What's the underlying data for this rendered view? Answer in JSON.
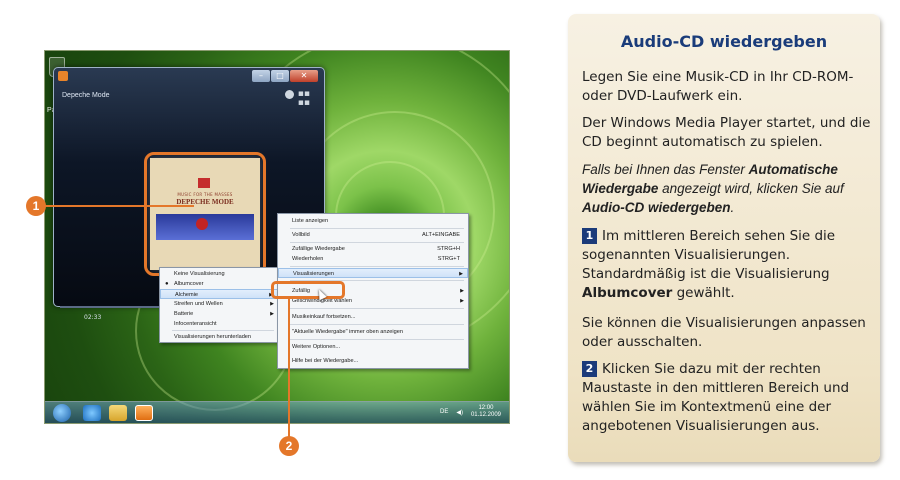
{
  "desktop": {
    "label_partial": "Pa"
  },
  "player": {
    "title": "Depeche Mode",
    "album_cover_line1": "MUSIC FOR THE MASSES",
    "album_cover_line2": "DEPECHE MODE",
    "time": "02:33"
  },
  "menu_left": {
    "items": [
      {
        "label": "Keine Visualisierung",
        "selected": false
      },
      {
        "label": "Albumcover",
        "selected": true
      },
      {
        "label": "Alchemie",
        "arrow": true,
        "highlighted": true
      },
      {
        "label": "Streifen und Wellen",
        "arrow": true
      },
      {
        "label": "Batterie",
        "arrow": true
      },
      {
        "label": "Infocenteransicht"
      },
      {
        "label": "Visualisierungen herunterladen"
      }
    ]
  },
  "menu_main": {
    "items": [
      {
        "label": "Liste anzeigen",
        "shortcut": ""
      },
      {
        "label": "Vollbild",
        "shortcut": "ALT+EINGABE"
      },
      {
        "label": "Zufällige Wiedergabe",
        "shortcut": "STRG+H"
      },
      {
        "label": "Wiederholen",
        "shortcut": "STRG+T"
      },
      {
        "label": "Visualisierungen",
        "arrow": true,
        "highlighted": true
      },
      {
        "label": "Zufällig",
        "arrow": true
      },
      {
        "label": "Geschwindigkeit wählen",
        "arrow": true
      },
      {
        "label": "Musikeinkauf fortsetzen..."
      },
      {
        "label": "\"Aktuelle Wiedergabe\" immer oben anzeigen"
      },
      {
        "label": "Weitere Optionen..."
      },
      {
        "label": "Hilfe bei der Wiedergabe..."
      }
    ],
    "sub_label_partial": "artitel"
  },
  "taskbar": {
    "lang": "DE",
    "clock_time": "12:00",
    "clock_date": "01.12.2009"
  },
  "callouts": [
    "1",
    "2"
  ],
  "panel": {
    "title": "Audio-CD wiedergeben",
    "p1": "Legen Sie eine Musik-CD in Ihr CD-ROM- oder DVD-Laufwerk ein.",
    "p2": "Der Windows Media Player startet, und die CD beginnt automatisch zu spielen.",
    "p3_a": "Falls bei Ihnen das Fenster ",
    "p3_b": "Automatische Wiedergabe",
    "p3_c": " angezeigt wird, klicken Sie auf ",
    "p3_d": "Audio-CD wiedergeben",
    "p3_e": ".",
    "step1_num": "1",
    "step1_a": "Im mittleren Bereich sehen Sie die sogenannten Visualisierungen. Standardmäßig ist die Visualisierung ",
    "step1_b": "Albumcover",
    "step1_c": " gewählt.",
    "p4": "Sie können die Visualisierungen anpassen oder ausschalten.",
    "step2_num": "2",
    "step2_text": "Klicken Sie dazu mit der rechten Maustaste in den mittleren Bereich und wählen Sie im Kontextmenü eine der angebotenen Visualisierungen aus."
  },
  "colors": {
    "accent_orange": "#e4772a",
    "title_blue": "#1a3c7a",
    "panel_bg": "#f3ead5"
  }
}
